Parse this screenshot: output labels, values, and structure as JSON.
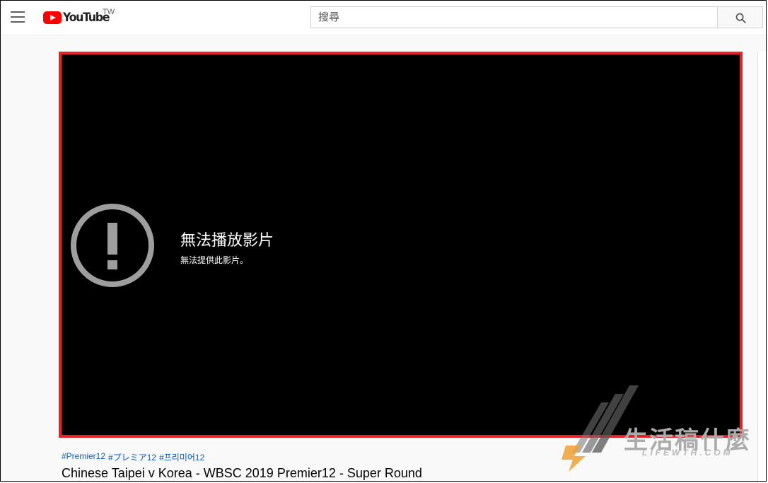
{
  "header": {
    "logo_text": "YouTube",
    "region": "TW",
    "search_placeholder": "搜尋"
  },
  "player": {
    "error_title": "無法播放影片",
    "error_message": "無法提供此影片。",
    "border_color": "#e42228"
  },
  "video": {
    "hashtags": [
      "#Premier12",
      "#プレミア12",
      "#프리미어12"
    ],
    "title": "Chinese Taipei v Korea - WBSC 2019 Premier12 - Super Round"
  },
  "watermark": {
    "text_cn": "生活稿什麼",
    "text_en": "LIFEWTH.COM"
  },
  "colors": {
    "brand_red": "#ff0000",
    "link_blue": "#065fd4"
  }
}
